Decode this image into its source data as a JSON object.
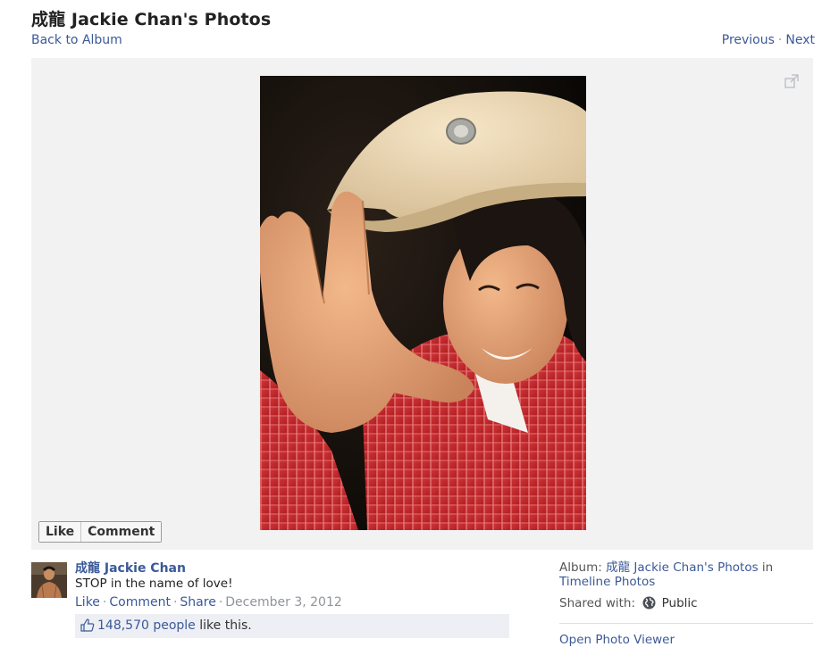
{
  "header": {
    "title": "成龍 Jackie Chan's Photos",
    "back_link": "Back to Album",
    "previous": "Previous",
    "separator": "·",
    "next": "Next"
  },
  "stage": {
    "like_button": "Like",
    "comment_button": "Comment",
    "expand_icon": "expand-icon"
  },
  "post": {
    "author": "成龍 Jackie Chan",
    "caption": "STOP in the name of love!",
    "actions": {
      "like": "Like",
      "comment": "Comment",
      "share": "Share",
      "separator": "·",
      "date": "December 3, 2012"
    },
    "likes": {
      "count": "148,570 people",
      "suffix": " like this."
    }
  },
  "sidebar": {
    "album_prefix": "Album: ",
    "album_name": "成龍 Jackie Chan's Photos",
    "album_in": " in",
    "album_section": "Timeline Photos",
    "shared_label": "Shared with:",
    "shared_value": "Public",
    "open_viewer": "Open Photo Viewer"
  },
  "colors": {
    "link": "#3b5998",
    "stage_bg": "#f2f2f2",
    "likes_bg": "#edeff4"
  }
}
